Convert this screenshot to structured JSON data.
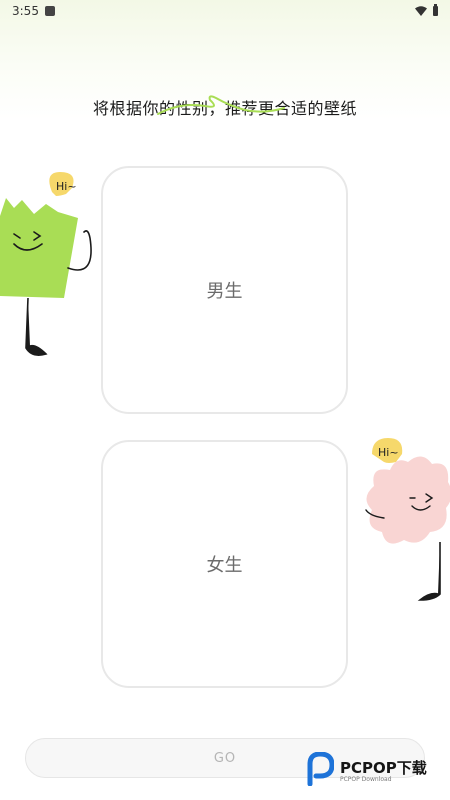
{
  "status_bar": {
    "time": "3:55"
  },
  "headline": {
    "text": "将根据你的性别，推荐更合适的壁纸"
  },
  "options": {
    "male_label": "男生",
    "female_label": "女生"
  },
  "mascots": {
    "left_greeting": "Hi~",
    "right_greeting": "Hi~"
  },
  "go_button": {
    "label": "GO"
  },
  "watermark": {
    "brand": "PCPOP下载",
    "subtitle": "PCPOP Download"
  },
  "colors": {
    "accent_green": "#a9dd55",
    "mascot_pink": "#f9d5d3",
    "speech_bubble": "#f6d86b",
    "watermark_blue": "#1e73d8",
    "card_border": "#e8e8e8"
  },
  "icons": [
    "app-notification-icon",
    "wifi-icon",
    "battery-icon",
    "pcpop-logo-icon"
  ]
}
